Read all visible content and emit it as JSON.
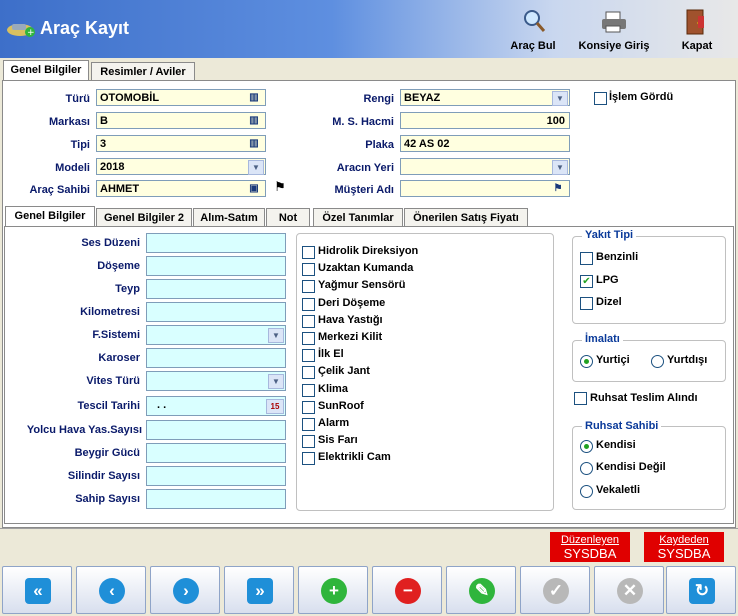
{
  "window": {
    "title": "Araç Kayıt"
  },
  "toolbar": {
    "arac_bul": "Araç Bul",
    "konsiye": "Konsiye Giriş",
    "kapat": "Kapat"
  },
  "main_tabs": [
    "Genel Bilgiler",
    "Resimler / Aviler"
  ],
  "vehicle": {
    "turu_label": "Türü",
    "turu": "OTOMOBİL",
    "markasi_label": "Markası",
    "markasi": "B",
    "tipi_label": "Tipi",
    "tipi": "3",
    "modeli_label": "Modeli",
    "modeli": "2018",
    "sahibi_label": "Araç Sahibi",
    "sahibi": "AHMET",
    "rengi_label": "Rengi",
    "rengi": "BEYAZ",
    "motor_label": "M. S. Hacmi",
    "motor": "100",
    "plaka_label": "Plaka",
    "plaka": "42 AS 02",
    "yeri_label": "Aracın Yeri",
    "yeri": "",
    "musteri_label": "Müşteri Adı",
    "musteri": "",
    "islem_label": "İşlem Gördü"
  },
  "sub_tabs": [
    "Genel Bilgiler",
    "Genel Bilgiler 2",
    "Alım-Satım",
    "Not",
    "Özel Tanımlar",
    "Önerilen Satış Fiyatı"
  ],
  "fields": {
    "ses": "Ses Düzeni",
    "doseme": "Döşeme",
    "teyp": "Teyp",
    "kilometre": "Kilometresi",
    "fsistemi": "F.Sistemi",
    "karoser": "Karoser",
    "vites": "Vites Türü",
    "tescil": "Tescil Tarihi",
    "tescil_value": ". .",
    "tescil_btn": "15",
    "yolcu": "Yolcu Hava Yas.Sayısı",
    "beygir": "Beygir Gücü",
    "silindir": "Silindir Sayısı",
    "sahip": "Sahip Sayısı"
  },
  "features": [
    "Hidrolik Direksiyon",
    "Uzaktan Kumanda",
    "Yağmur Sensörü",
    "Deri Döşeme",
    "Hava Yastığı",
    "Merkezi Kilit",
    "İlk El",
    "Çelik Jant",
    "Klima",
    "SunRoof",
    "Alarm",
    "Sis Farı",
    "Elektrikli Cam"
  ],
  "yakit": {
    "title": "Yakıt Tipi",
    "options": [
      "Benzinli",
      "LPG",
      "Dizel"
    ],
    "checked": "LPG"
  },
  "imalat": {
    "title": "İmalatı",
    "options": [
      "Yurtiçi",
      "Yurtdışı"
    ],
    "selected": "Yurtiçi"
  },
  "ruhsat_teslim": "Ruhsat Teslim Alındı",
  "ruhsat_sahibi": {
    "title": "Ruhsat Sahibi",
    "options": [
      "Kendisi",
      "Kendisi Değil",
      "Vekaletli"
    ],
    "selected": "Kendisi"
  },
  "footer": {
    "duzenleyen_label": "Düzenleyen",
    "duzenleyen": "SYSDBA",
    "kaydeden_label": "Kaydeden",
    "kaydeden": "SYSDBA"
  },
  "colors": {
    "nav_blue": "#1f8fd8",
    "add_green": "#2fb53c",
    "delete_red": "#e02020",
    "disabled_gray": "#b8b8b8"
  }
}
